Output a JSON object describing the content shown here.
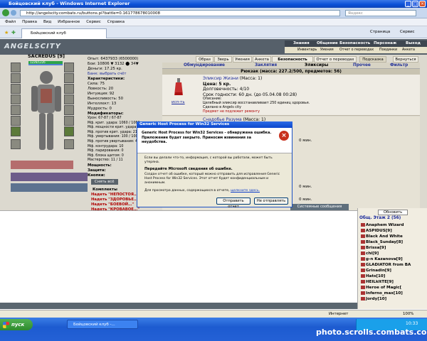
{
  "window": {
    "title": "Бойцовский клуб - Windows Internet Explorer"
  },
  "address": {
    "url": "http://angelscity.combats.ru/buttons.pl?battle=0.161778678010008",
    "search_placeholder": "Яндекс"
  },
  "menu": [
    "Файл",
    "Правка",
    "Вид",
    "Избранное",
    "Сервис",
    "Справка"
  ],
  "tab": {
    "label": "Бойцовский клуб"
  },
  "toolbar": {
    "page": "Страница",
    "tools": "Сервис"
  },
  "game": {
    "logo": "ANGELSCITY",
    "topnav": [
      "Знания",
      "Общение",
      "Безопасность",
      "Персонаж",
      "Выход"
    ],
    "subnav": [
      "Инвентарь",
      "Умения",
      "Отчет о переводах",
      "Поединки",
      "Анкета"
    ],
    "char": {
      "name": "SACREDUS",
      "level": "[9]",
      "hp": "1226/1226"
    },
    "stats_top": [
      "Опыт: 6437933 (6500000)",
      "Бои: 10806 ▼ 3132 ⬤ 34▼",
      "Деньги: 17.25 кр.",
      "Банк: выбрать счёт"
    ],
    "characteristics_label": "Характеристики:",
    "characteristics": [
      "Сила: 75",
      "Ловкость: 20",
      "Интуиция: 92",
      "Выносливость: 50",
      "Интеллект: 13",
      "Мудрость: 0"
    ],
    "modifiers_label": "Модификаторы:",
    "modifiers": [
      "Урон: 67-87 / 67-87",
      "Мф. крит. удара: 1060 / 1060",
      "Мф. мощности крит. удара: 180",
      "Мф. против крит. удара: 210",
      "Мф. увертывания: 100 / 100",
      "Мф. против увертывания: 420",
      "Мф. контрудара: 10",
      "Мф. парирования: 0",
      "Мф. блока щитом: 0",
      "Мастерство: 11 / 11"
    ],
    "sections": [
      "Мощность:",
      "Защита:",
      "Кнопки:"
    ],
    "undress_button": "Снять всё",
    "complects_label": "Комплекты",
    "complects": [
      "Надеть \"НЕПОСТОЯ…\"",
      "Надеть \"ЗДОРОВЬЕ…\"",
      "Надеть \"БОЕВОЙ…\"",
      "Надеть \"КРОВАВОЕ…\""
    ],
    "tabs_top": [
      "Образ",
      "Зверь",
      "Умения",
      "Анкета",
      "Безопасность",
      "Отчет о переводах",
      "Подсказка",
      "Вернуться"
    ],
    "inv_tabs": [
      "Обмундирование",
      "Заклятия",
      "Эликсиры",
      "Прочее",
      "Фильтр"
    ],
    "backpack": "Рюкзак (масса: 227.2/500, предметов: 56)",
    "item1": {
      "name": "Эликсир Жизни",
      "mass": "(Масса: 1)",
      "price": "Цена: 5 кр.",
      "durability": "Долговечность: 4/10",
      "expiry": "Срок годности: 60 дн. (до 05.04.08 00:28)",
      "desc_label": "Описание:",
      "desc": "Целебный эликсир восстанавливает 250 единиц здоровья.",
      "made": "Сделано в Angels city",
      "warn": "Предмет не подлежит ремонту",
      "use": "исп-ть"
    },
    "item2": {
      "name": "Снадобье Разума",
      "mass": "(Масса: 1)"
    },
    "right_small": [
      "0 мин.",
      "0 мин.",
      "0 мин."
    ],
    "chat_tab": "Системные сообщения",
    "refresh_button": "Обновить",
    "online_title": "Общ. Этаж 2 (56)",
    "online": [
      "Anaphem Wizard",
      "ASPIDUS[9]",
      "Black And White",
      "Black_Sunday[8]",
      "Brissa[9]",
      "chi[9]",
      "g-n Kazanova[9]",
      "GLADIATOR from BA",
      "Grinadin[9]",
      "Hats[10]",
      "HElLkltTE[9]",
      "Heroe of Magic[",
      "Inferno_max[10]",
      "Jordy[10]"
    ]
  },
  "dialog": {
    "title": "Generic Host Process for Win32 Services",
    "heading": "Generic Host Process for Win32 Services - обнаружена ошибка. Приложение будет закрыто. Приносим извинения за неудобства.",
    "info": "Если вы делали что-то, информация, с которой вы работали, может быть утеряна.",
    "report_heading": "Передайте Microsoft сведения об ошибке.",
    "report_text": "Создан отчет об ошибке, который можно отправить для исправления Generic Host Process for Win32 Services. Этот отчет будет конфиденциальным и анонимным.",
    "data_text": "Для просмотра данных, содержащихся в отчете,",
    "data_link": "щелкните здесь.",
    "send_button": "Отправить отчет",
    "dont_send_button": "Не отправлять"
  },
  "statusbar": {
    "zone": "Интернет",
    "zoom": "100%"
  },
  "taskbar": {
    "start": "пуск",
    "item": "Бойцовский клуб -...",
    "clock": "10:33"
  },
  "watermark": "photo.scrolls.combats.com"
}
